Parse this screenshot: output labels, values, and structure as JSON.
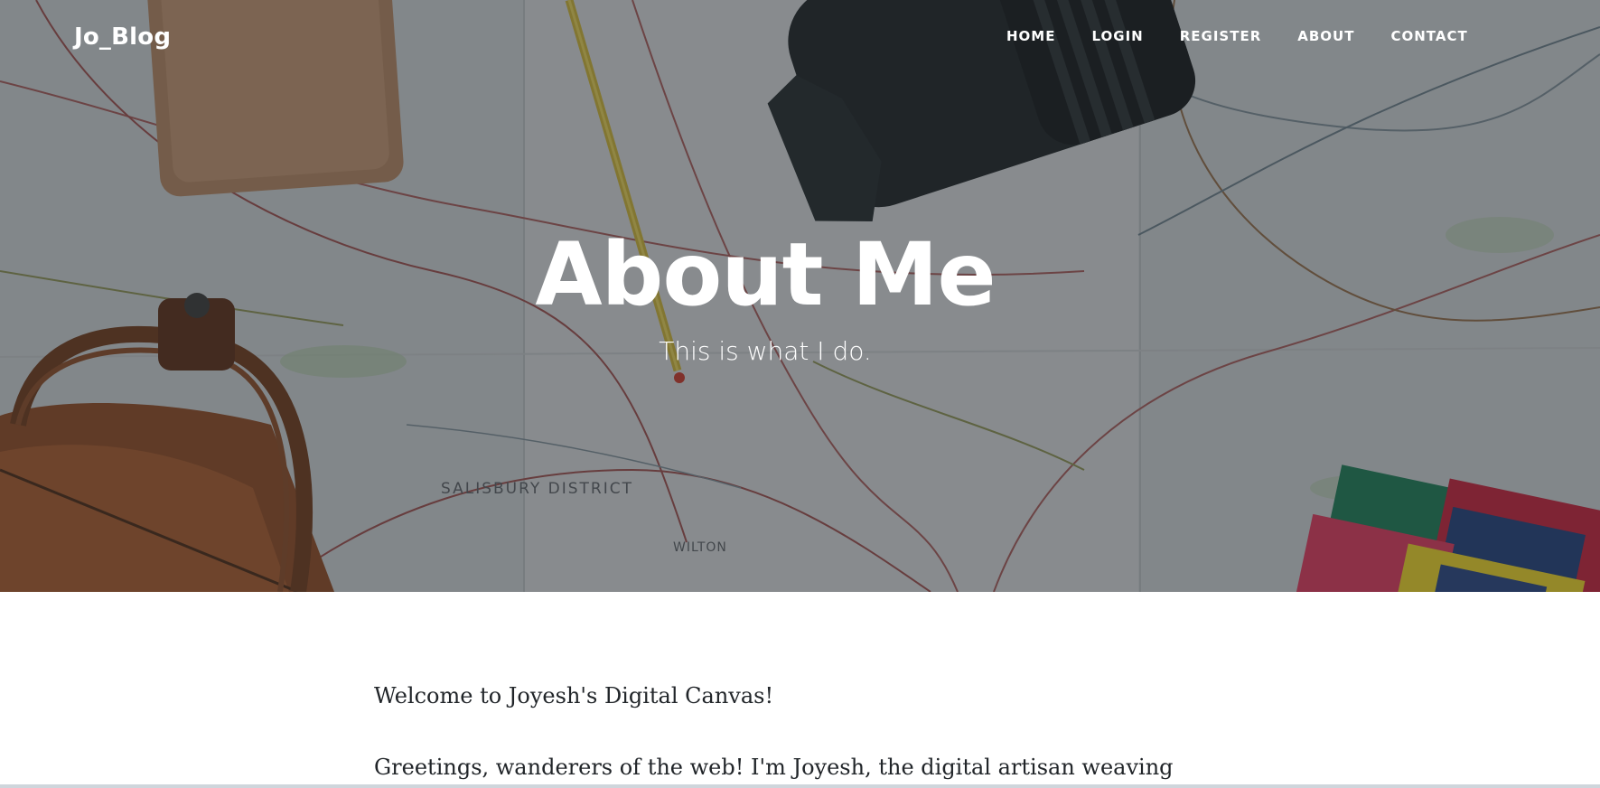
{
  "nav": {
    "brand": "Jo_Blog",
    "links": [
      {
        "label": "HOME"
      },
      {
        "label": "LOGIN"
      },
      {
        "label": "REGISTER"
      },
      {
        "label": "ABOUT"
      },
      {
        "label": "CONTACT"
      }
    ]
  },
  "hero": {
    "title": "About Me",
    "subtitle": "This is what I do.",
    "map_text": {
      "district": "SALISBURY DISTRICT",
      "town": "WILTON"
    }
  },
  "content": {
    "paragraphs": [
      "Welcome to Joyesh's Digital Canvas!",
      "Greetings, wanderers of the web! I'm Joyesh, the digital artisan weaving"
    ]
  },
  "colors": {
    "overlay": "#212529",
    "text": "#212529",
    "hero_text": "#ffffff"
  }
}
